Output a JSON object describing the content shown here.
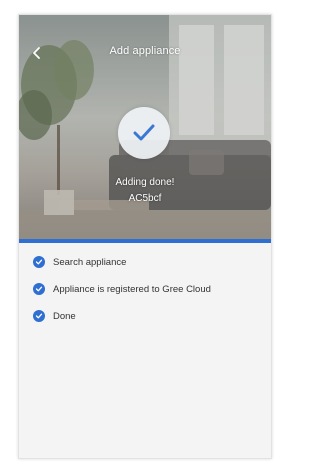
{
  "header": {
    "title": "Add appliance",
    "back_icon": "chevron-left-icon"
  },
  "hero": {
    "status_icon": "checkmark-icon",
    "status_title": "Adding done!",
    "device_name": "AC5bcf"
  },
  "progress": {
    "fraction": 1.0
  },
  "steps": [
    {
      "label": "Search appliance",
      "state": "done",
      "icon": "check-dot-icon"
    },
    {
      "label": "Appliance is registered to Gree Cloud",
      "state": "done",
      "icon": "check-dot-icon"
    },
    {
      "label": "Done",
      "state": "done",
      "icon": "check-dot-icon"
    }
  ],
  "colors": {
    "accent": "#2f6fd1",
    "background": "#f4f4f4",
    "text": "#333333"
  }
}
